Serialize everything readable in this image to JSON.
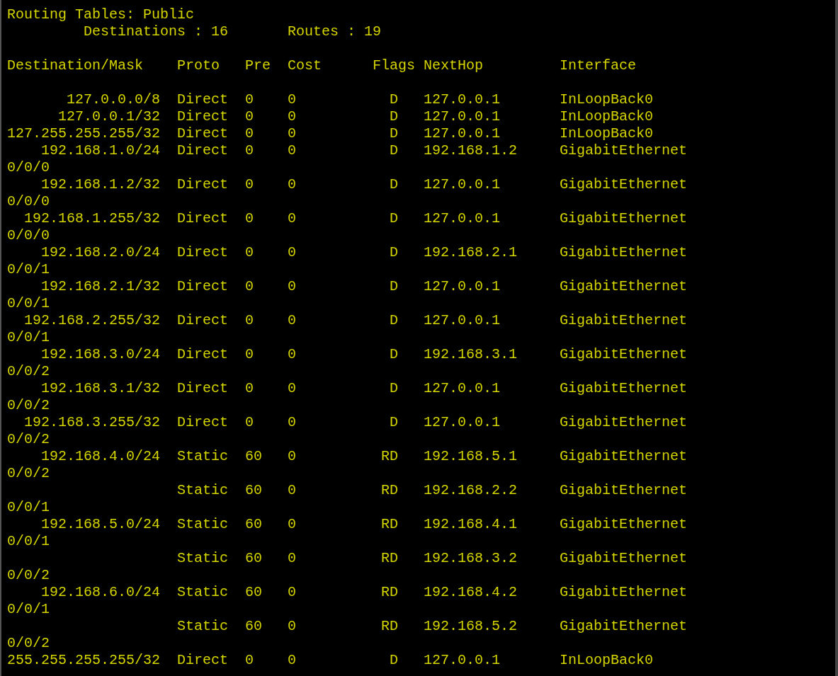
{
  "title": "Routing Tables: Public",
  "summary": {
    "destinations_label": "Destinations : 16",
    "routes_label": "Routes : 19"
  },
  "columns": [
    "Destination/Mask",
    "Proto",
    "Pre",
    "Cost",
    "Flags",
    "NextHop",
    "Interface"
  ],
  "rows": [
    {
      "destination": "127.0.0.0/8",
      "proto": "Direct",
      "pre": "0",
      "cost": "0",
      "flags": "D",
      "nexthop": "127.0.0.1",
      "interface": "InLoopBack0"
    },
    {
      "destination": "127.0.0.1/32",
      "proto": "Direct",
      "pre": "0",
      "cost": "0",
      "flags": "D",
      "nexthop": "127.0.0.1",
      "interface": "InLoopBack0"
    },
    {
      "destination": "127.255.255.255/32",
      "proto": "Direct",
      "pre": "0",
      "cost": "0",
      "flags": "D",
      "nexthop": "127.0.0.1",
      "interface": "InLoopBack0"
    },
    {
      "destination": "192.168.1.0/24",
      "proto": "Direct",
      "pre": "0",
      "cost": "0",
      "flags": "D",
      "nexthop": "192.168.1.2",
      "interface": "GigabitEthernet",
      "interface_wrap": "0/0/0"
    },
    {
      "destination": "192.168.1.2/32",
      "proto": "Direct",
      "pre": "0",
      "cost": "0",
      "flags": "D",
      "nexthop": "127.0.0.1",
      "interface": "GigabitEthernet",
      "interface_wrap": "0/0/0"
    },
    {
      "destination": "192.168.1.255/32",
      "proto": "Direct",
      "pre": "0",
      "cost": "0",
      "flags": "D",
      "nexthop": "127.0.0.1",
      "interface": "GigabitEthernet",
      "interface_wrap": "0/0/0"
    },
    {
      "destination": "192.168.2.0/24",
      "proto": "Direct",
      "pre": "0",
      "cost": "0",
      "flags": "D",
      "nexthop": "192.168.2.1",
      "interface": "GigabitEthernet",
      "interface_wrap": "0/0/1"
    },
    {
      "destination": "192.168.2.1/32",
      "proto": "Direct",
      "pre": "0",
      "cost": "0",
      "flags": "D",
      "nexthop": "127.0.0.1",
      "interface": "GigabitEthernet",
      "interface_wrap": "0/0/1"
    },
    {
      "destination": "192.168.2.255/32",
      "proto": "Direct",
      "pre": "0",
      "cost": "0",
      "flags": "D",
      "nexthop": "127.0.0.1",
      "interface": "GigabitEthernet",
      "interface_wrap": "0/0/1"
    },
    {
      "destination": "192.168.3.0/24",
      "proto": "Direct",
      "pre": "0",
      "cost": "0",
      "flags": "D",
      "nexthop": "192.168.3.1",
      "interface": "GigabitEthernet",
      "interface_wrap": "0/0/2"
    },
    {
      "destination": "192.168.3.1/32",
      "proto": "Direct",
      "pre": "0",
      "cost": "0",
      "flags": "D",
      "nexthop": "127.0.0.1",
      "interface": "GigabitEthernet",
      "interface_wrap": "0/0/2"
    },
    {
      "destination": "192.168.3.255/32",
      "proto": "Direct",
      "pre": "0",
      "cost": "0",
      "flags": "D",
      "nexthop": "127.0.0.1",
      "interface": "GigabitEthernet",
      "interface_wrap": "0/0/2"
    },
    {
      "destination": "192.168.4.0/24",
      "proto": "Static",
      "pre": "60",
      "cost": "0",
      "flags": "RD",
      "nexthop": "192.168.5.1",
      "interface": "GigabitEthernet",
      "interface_wrap": "0/0/2"
    },
    {
      "proto": "Static",
      "pre": "60",
      "cost": "0",
      "flags": "RD",
      "nexthop": "192.168.2.2",
      "interface": "GigabitEthernet",
      "interface_wrap": "0/0/1"
    },
    {
      "destination": "192.168.5.0/24",
      "proto": "Static",
      "pre": "60",
      "cost": "0",
      "flags": "RD",
      "nexthop": "192.168.4.1",
      "interface": "GigabitEthernet",
      "interface_wrap": "0/0/1"
    },
    {
      "proto": "Static",
      "pre": "60",
      "cost": "0",
      "flags": "RD",
      "nexthop": "192.168.3.2",
      "interface": "GigabitEthernet",
      "interface_wrap": "0/0/2"
    },
    {
      "destination": "192.168.6.0/24",
      "proto": "Static",
      "pre": "60",
      "cost": "0",
      "flags": "RD",
      "nexthop": "192.168.4.2",
      "interface": "GigabitEthernet",
      "interface_wrap": "0/0/1"
    },
    {
      "proto": "Static",
      "pre": "60",
      "cost": "0",
      "flags": "RD",
      "nexthop": "192.168.5.2",
      "interface": "GigabitEthernet",
      "interface_wrap": "0/0/2"
    },
    {
      "destination": "255.255.255.255/32",
      "proto": "Direct",
      "pre": "0",
      "cost": "0",
      "flags": "D",
      "nexthop": "127.0.0.1",
      "interface": "InLoopBack0"
    }
  ]
}
